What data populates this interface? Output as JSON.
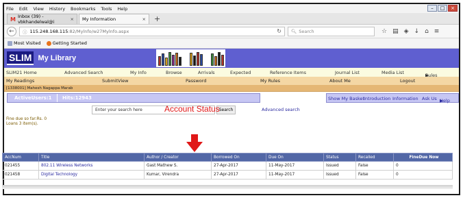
{
  "browser": {
    "menu": [
      "File",
      "Edit",
      "View",
      "History",
      "Bookmarks",
      "Tools",
      "Help"
    ],
    "tabs": [
      {
        "label": "Inbox (39) - vbkhandelwal@i",
        "close": "×"
      },
      {
        "label": "My Information",
        "close": "×"
      }
    ],
    "new_tab": "+",
    "url_host": "115.248.168.115",
    "url_rest": ":82/Mylnfo/w27Mylnfo.aspx",
    "search_placeholder": "Search",
    "bookmarks": [
      "Most Visited",
      "Getting Started"
    ]
  },
  "site": {
    "logo": "SLIM",
    "title": "My Library",
    "main_menu": [
      "SLIM21 Home",
      "Advanced Search",
      "My Info",
      "Browse",
      "Arrivals",
      "Expected",
      "Reference Items",
      "Journal List",
      "Media List",
      "Rules"
    ],
    "sub_menu": [
      "My Readings",
      "SubmitView",
      "Password",
      "My Rules",
      "About Me",
      "Logout"
    ],
    "user_line": "[1338001] Mahesh Nagappa Marab",
    "active_users": "ActiveUsers:1",
    "hits": "Hits:12943",
    "right_links": [
      "Show My Basket",
      "Introduction",
      "Information",
      "Ask Us",
      "Help"
    ],
    "search_placeholder": "Enter your search here",
    "search_button": "Search",
    "advanced_search": "Advanced search",
    "account_status": "Account Status",
    "fine_due": "Fine due so far:Rs. 0",
    "loans": "Loans 3 item(s)."
  },
  "loans_table": {
    "headers": [
      "AccNum",
      "Title",
      "Author / Creator",
      "Borrowed On",
      "Due On",
      "Status",
      "Recalled",
      "FineDue Now"
    ],
    "rows": [
      [
        "021455",
        "802.11 Wireless Networks",
        "Gast Mathew S.",
        "27-Apr-2017",
        "11-May-2017",
        "Issued",
        "False",
        "0"
      ],
      [
        "021458",
        "Digital Technology",
        "Kumar, Virendra",
        "27-Apr-2017",
        "11-May-2017",
        "Issued",
        "False",
        "0"
      ]
    ]
  },
  "colors": {
    "banner": "#5f5fd0",
    "submenu": "#f4d7a4",
    "table_header": "#5267a6",
    "annotation_red": "#e01818"
  }
}
